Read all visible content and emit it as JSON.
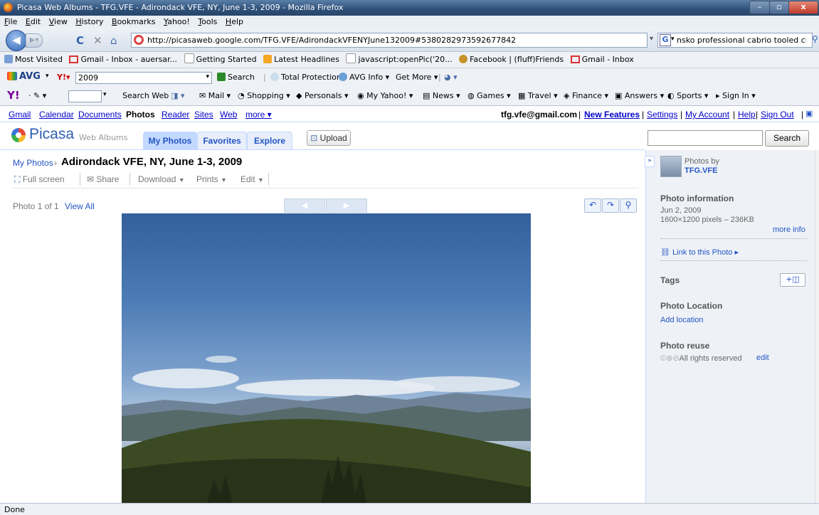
{
  "window": {
    "title": "Picasa Web Albums - TFG.VFE - Adirondack VFE, NY, June 1-3, 2009 - Mozilla Firefox"
  },
  "menu": [
    "File",
    "Edit",
    "View",
    "History",
    "Bookmarks",
    "Yahoo!",
    "Tools",
    "Help"
  ],
  "nav": {
    "url": "http://picasaweb.google.com/TFG.VFE/AdirondackVFENYJune132009#5380282973592677842",
    "search_value": "nsko professional cabrio tooled clogs"
  },
  "bookmarks": [
    "Most Visited",
    "Gmail - Inbox - auersar...",
    "Getting Started",
    "Latest Headlines",
    "javascript:openPic('20...",
    "Facebook | (fluff)Friends",
    "Gmail - Inbox"
  ],
  "avg": {
    "logo": "AVG",
    "query": "2009",
    "search": "Search",
    "protection": "Total Protection",
    "info": "AVG Info",
    "more": "Get More"
  },
  "yahoo": {
    "search_web": "Search Web",
    "items": [
      "Mail",
      "Shopping",
      "Personals",
      "My Yahoo!",
      "News",
      "Games",
      "Travel",
      "Finance",
      "Answers",
      "Sports",
      "Sign In"
    ]
  },
  "gbar": {
    "links": [
      "Gmail",
      "Calendar",
      "Documents",
      "Photos",
      "Reader",
      "Sites",
      "Web",
      "more ▾"
    ],
    "email": "tfg.vfe@gmail.com",
    "right": [
      "New Features",
      "Settings",
      "My Account",
      "Help",
      "Sign Out"
    ]
  },
  "picasa": {
    "logo": "Picasa",
    "logo_sub": "Web Albums",
    "tabs": [
      "My Photos",
      "Favorites",
      "Explore"
    ],
    "upload": "Upload",
    "search_btn": "Search"
  },
  "album": {
    "crumb_root": "My Photos",
    "crumb_sep": "›",
    "title": "Adirondack VFE, NY, June 1-3, 2009",
    "actions": [
      "Full screen",
      "Share",
      "Download",
      "Prints",
      "Edit"
    ],
    "photo_count": "Photo 1 of 1",
    "view_all": "View All"
  },
  "sidebar": {
    "photos_by": "Photos by",
    "owner": "TFG.VFE",
    "info_head": "Photo information",
    "date": "Jun 2, 2009",
    "size": "1600×1200 pixels – 236KB",
    "more_info": "more info",
    "link": "Link to this Photo ▸",
    "tags": "Tags",
    "location_head": "Photo Location",
    "add_location": "Add location",
    "reuse_head": "Photo reuse",
    "reuse_text": "All rights reserved",
    "edit": "edit"
  },
  "status": "Done"
}
